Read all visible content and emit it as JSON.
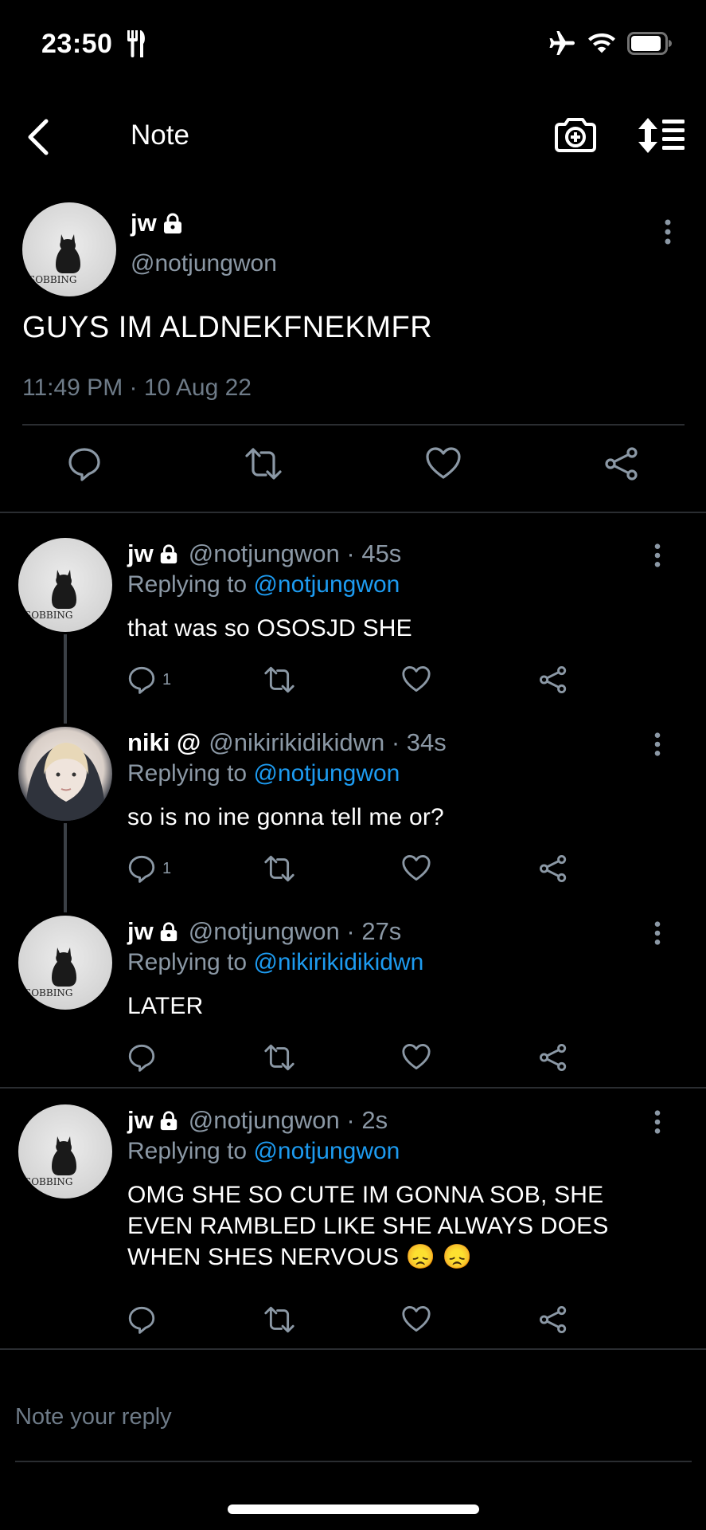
{
  "status_bar": {
    "time": "23:50"
  },
  "nav": {
    "title": "Note"
  },
  "main_tweet": {
    "name": "jw",
    "handle": "@notjungwon",
    "avatar_caption": "SOBBING",
    "text": "GUYS IM ALDNEKFNEKMFR",
    "timestamp": "11:49 PM · 10 Aug 22"
  },
  "replies": [
    {
      "name": "jw",
      "locked": true,
      "meta": "@notjungwon · 45s",
      "replying_prefix": "Replying to ",
      "replying_to": "@notjungwon",
      "text": "that was so OSOSJD SHE",
      "reply_count": "1",
      "avatar_caption": "SOBBING"
    },
    {
      "name": "niki @",
      "locked": false,
      "meta": "@nikirikidikidwn · 34s",
      "replying_prefix": "Replying to ",
      "replying_to": "@notjungwon",
      "text": "so is no ine gonna tell me or?",
      "reply_count": "1"
    },
    {
      "name": "jw",
      "locked": true,
      "meta": "@notjungwon · 27s",
      "replying_prefix": "Replying to ",
      "replying_to": "@nikirikidikidwn",
      "text": "LATER",
      "reply_count": "",
      "avatar_caption": "SOBBING"
    },
    {
      "name": "jw",
      "locked": true,
      "meta": "@notjungwon · 2s",
      "replying_prefix": "Replying to ",
      "replying_to": "@notjungwon",
      "text_line1": "OMG SHE SO CUTE IM GONNA SOB, SHE",
      "text_line2": "EVEN RAMBLED LIKE SHE ALWAYS DOES",
      "text_line3": "WHEN SHES NERVOUS 😞 😞",
      "reply_count": "",
      "avatar_caption": "SOBBING"
    }
  ],
  "composer": {
    "placeholder": "Note your reply"
  },
  "colors": {
    "background": "#000000",
    "accent": "#1d9bf0",
    "muted": "#8b98a5",
    "divider": "#2a2d31"
  }
}
